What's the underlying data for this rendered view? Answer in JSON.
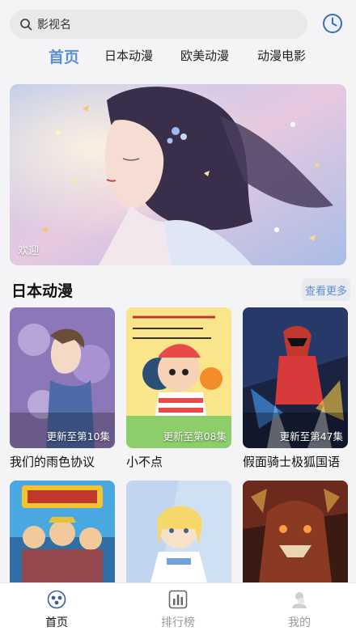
{
  "search": {
    "placeholder": "影视名",
    "icon": "search-icon"
  },
  "header": {
    "history_icon": "clock-icon"
  },
  "tabs": [
    {
      "label": "首页",
      "active": true
    },
    {
      "label": "日本动漫",
      "active": false
    },
    {
      "label": "欧美动漫",
      "active": false
    },
    {
      "label": "动漫电影",
      "active": false
    }
  ],
  "banner": {
    "caption": "欢迎"
  },
  "section": {
    "title": "日本动漫",
    "more_label": "查看更多"
  },
  "cards_row1": [
    {
      "title": "我们的雨色协议",
      "badge": "更新至第10集"
    },
    {
      "title": "小不点",
      "badge": "更新至第08集"
    },
    {
      "title": "假面骑士极狐国语",
      "badge": "更新至第47集"
    }
  ],
  "cards_row2": [
    {
      "title": ""
    },
    {
      "title": ""
    },
    {
      "title": ""
    }
  ],
  "bottom_nav": [
    {
      "label": "首页",
      "icon": "home-icon",
      "active": true
    },
    {
      "label": "排行榜",
      "icon": "ranking-icon",
      "active": false
    },
    {
      "label": "我的",
      "icon": "profile-icon",
      "active": false
    }
  ],
  "colors": {
    "accent": "#5a8fd8",
    "background": "#f4f4f6"
  }
}
